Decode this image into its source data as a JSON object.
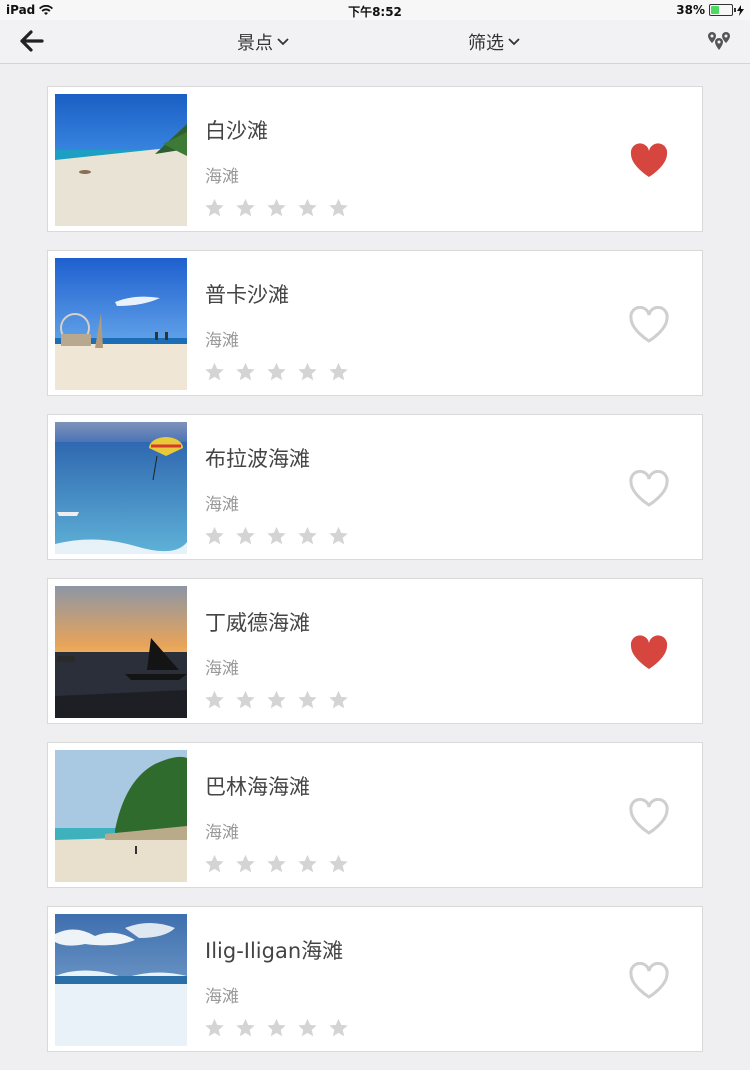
{
  "status_bar": {
    "device": "iPad",
    "time": "下午8:52",
    "battery": "38%",
    "battery_level": 0.38
  },
  "nav": {
    "back_icon": "arrow-left-icon",
    "scene_label": "景点",
    "filter_label": "筛选",
    "map_icon": "map-pins-icon"
  },
  "colors": {
    "favorite_active": "#d6463f",
    "favorite_inactive": "#cfcfcf",
    "star": "#d4d4d4"
  },
  "items": [
    {
      "name": "白沙滩",
      "category": "海滩",
      "rating": 0,
      "favorited": true
    },
    {
      "name": "普卡沙滩",
      "category": "海滩",
      "rating": 0,
      "favorited": false
    },
    {
      "name": "布拉波海滩",
      "category": "海滩",
      "rating": 0,
      "favorited": false
    },
    {
      "name": "丁威德海滩",
      "category": "海滩",
      "rating": 0,
      "favorited": true
    },
    {
      "name": "巴林海海滩",
      "category": "海滩",
      "rating": 0,
      "favorited": false
    },
    {
      "name": "Ilig-Iligan海滩",
      "category": "海滩",
      "rating": 0,
      "favorited": false
    }
  ]
}
